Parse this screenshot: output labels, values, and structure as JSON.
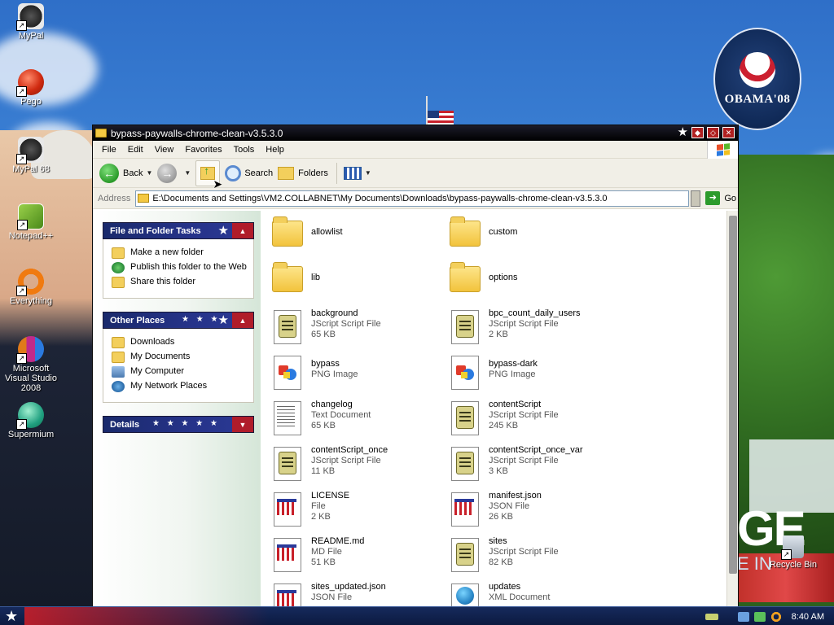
{
  "desktop": {
    "icons": [
      {
        "label": "MyPal"
      },
      {
        "label": "Pego"
      },
      {
        "label": "MyPal 68"
      },
      {
        "label": "Notepad++"
      },
      {
        "label": "Everything"
      },
      {
        "label": "Microsoft Visual Studio 2008"
      },
      {
        "label": "Supermium"
      },
      {
        "label": "Recycle Bin"
      }
    ],
    "obama_logo": "OBAMA'08",
    "wallpaper_text": "GE",
    "wallpaper_subtext": "E IN"
  },
  "window": {
    "title": "bypass-paywalls-chrome-clean-v3.5.3.0",
    "menu": [
      "File",
      "Edit",
      "View",
      "Favorites",
      "Tools",
      "Help"
    ],
    "toolbar": {
      "back": "Back",
      "search": "Search",
      "folders": "Folders"
    },
    "address": {
      "label": "Address",
      "value": "E:\\Documents and Settings\\VM2.COLLABNET\\My Documents\\Downloads\\bypass-paywalls-chrome-clean-v3.5.3.0",
      "go": "Go"
    }
  },
  "taskpane": {
    "file_tasks": {
      "title": "File and Folder Tasks",
      "items": [
        "Make a new folder",
        "Publish this folder to the Web",
        "Share this folder"
      ]
    },
    "other_places": {
      "title": "Other Places",
      "items": [
        "Downloads",
        "My Documents",
        "My Computer",
        "My Network Places"
      ]
    },
    "details": {
      "title": "Details"
    }
  },
  "files": [
    {
      "name": "allowlist",
      "kind": "folder"
    },
    {
      "name": "custom",
      "kind": "folder"
    },
    {
      "name": "lib",
      "kind": "folder"
    },
    {
      "name": "options",
      "kind": "folder"
    },
    {
      "name": "background",
      "type": "JScript Script File",
      "size": "65 KB",
      "kind": "js"
    },
    {
      "name": "bpc_count_daily_users",
      "type": "JScript Script File",
      "size": "2 KB",
      "kind": "js"
    },
    {
      "name": "bypass",
      "type": "PNG Image",
      "size": "",
      "kind": "png"
    },
    {
      "name": "bypass-dark",
      "type": "PNG Image",
      "size": "",
      "kind": "png"
    },
    {
      "name": "changelog",
      "type": "Text Document",
      "size": "65 KB",
      "kind": "txt"
    },
    {
      "name": "contentScript",
      "type": "JScript Script File",
      "size": "245 KB",
      "kind": "js"
    },
    {
      "name": "contentScript_once",
      "type": "JScript Script File",
      "size": "11 KB",
      "kind": "js"
    },
    {
      "name": "contentScript_once_var",
      "type": "JScript Script File",
      "size": "3 KB",
      "kind": "js"
    },
    {
      "name": "LICENSE",
      "type": "File",
      "size": "2 KB",
      "kind": "win"
    },
    {
      "name": "manifest.json",
      "type": "JSON File",
      "size": "26 KB",
      "kind": "win"
    },
    {
      "name": "README.md",
      "type": "MD File",
      "size": "51 KB",
      "kind": "win"
    },
    {
      "name": "sites",
      "type": "JScript Script File",
      "size": "82 KB",
      "kind": "js"
    },
    {
      "name": "sites_updated.json",
      "type": "JSON File",
      "size": "",
      "kind": "win"
    },
    {
      "name": "updates",
      "type": "XML Document",
      "size": "",
      "kind": "xml"
    }
  ],
  "taskbar": {
    "clock": "8:40 AM"
  }
}
